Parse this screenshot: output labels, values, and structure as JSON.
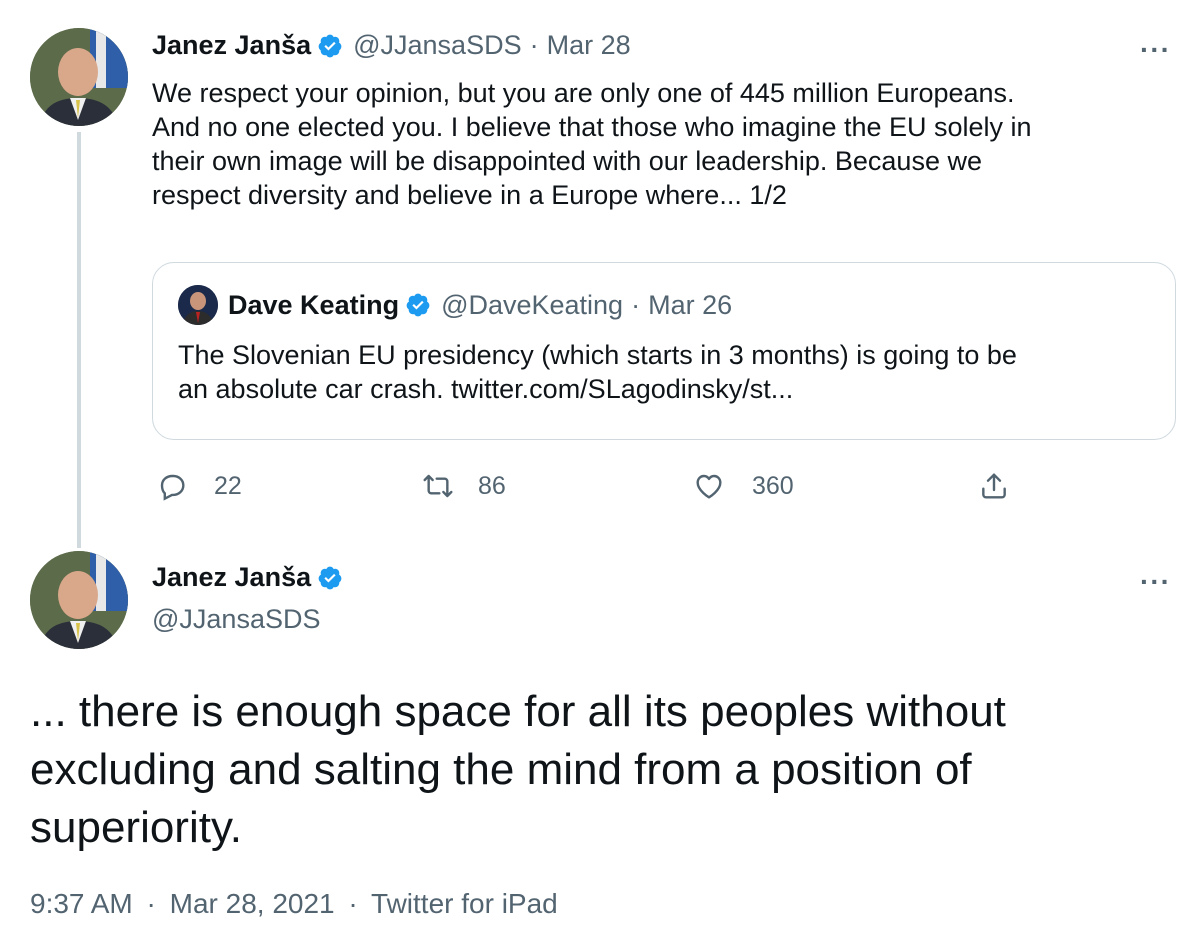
{
  "tweet1": {
    "author_name": "Janez Janša",
    "handle": "@JJansaSDS",
    "date": "Mar 28",
    "text_lines": [
      "We respect your opinion, but you are only one of 445 million Europeans.",
      "And no one elected you. I believe that those who imagine the EU solely in",
      "their own image will be disappointed with our leadership.  Because we",
      "respect diversity and believe in a Europe where... 1/2"
    ],
    "quote": {
      "author_name": "Dave Keating",
      "handle": "@DaveKeating",
      "date": "Mar 26",
      "text_lines": [
        "The Slovenian EU presidency (which starts in 3 months) is going to be",
        "an absolute car crash. twitter.com/SLagodinsky/st..."
      ]
    },
    "actions": {
      "replies": "22",
      "retweets": "86",
      "likes": "360"
    }
  },
  "tweet2": {
    "author_name": "Janez Janša",
    "handle": "@JJansaSDS",
    "text_lines": [
      "... there is enough space for all its peoples without",
      "excluding and salting the mind from a position of",
      "superiority."
    ],
    "footer": {
      "time": "9:37 AM",
      "date": "Mar 28, 2021",
      "source": "Twitter for iPad"
    }
  },
  "separator": "·",
  "more_glyph": "···",
  "colors": {
    "verified": "#1d9bf0",
    "secondary_text": "#536471",
    "primary_text": "#0f1419",
    "border": "#cfd9de"
  },
  "icons": [
    "verified-badge-icon",
    "more-icon",
    "reply-icon",
    "retweet-icon",
    "like-icon",
    "share-icon"
  ]
}
